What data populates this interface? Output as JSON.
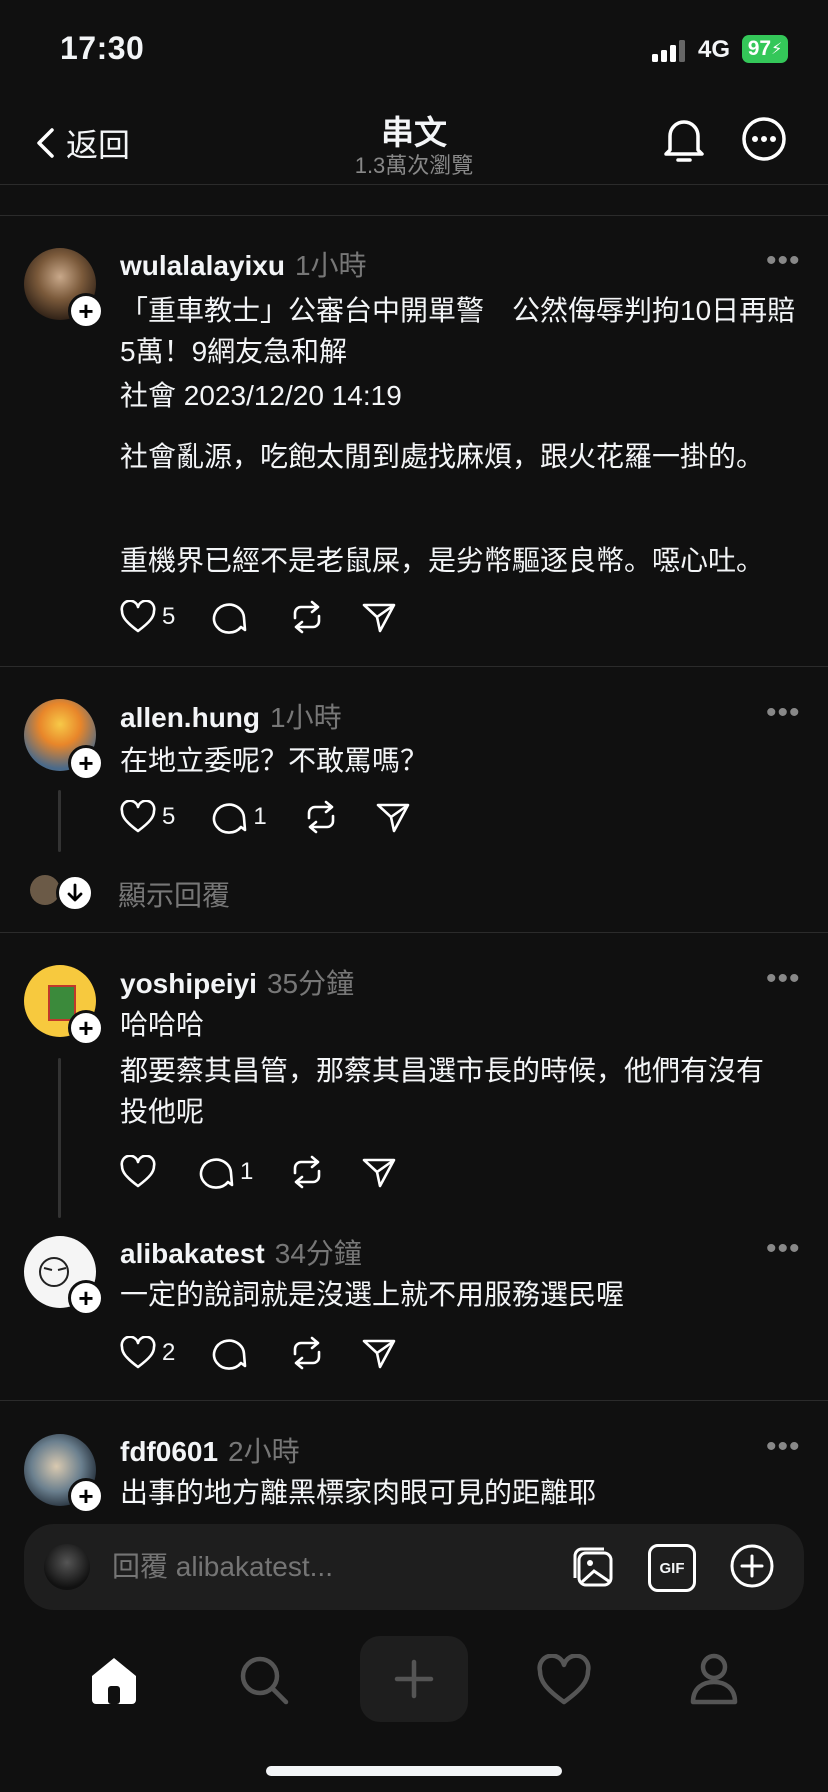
{
  "status": {
    "time": "17:30",
    "network": "4G",
    "battery": "97"
  },
  "header": {
    "back_label": "返回",
    "title": "串文",
    "views": "1.3萬次瀏覽"
  },
  "posts": [
    {
      "username": "wulalalayixu",
      "time": "1小時",
      "lines": [
        "「重車教士」公審台中開單警　公然侮辱判拘10日再賠5萬！9網友急和解",
        "社會 2023/12/20 14:19"
      ],
      "paragraphs": [
        "社會亂源，吃飽太閒到處找麻煩，跟火花羅一掛的。",
        "重機界已經不是老鼠屎，是劣幣驅逐良幣。噁心吐。"
      ],
      "likes": "5",
      "replies": ""
    },
    {
      "username": "allen.hung",
      "time": "1小時",
      "text": "在地立委呢？不敢罵嗎？",
      "likes": "5",
      "replies": "1",
      "show_replies": "顯示回覆"
    },
    {
      "username": "yoshipeiyi",
      "time": "35分鐘",
      "text1": "哈哈哈",
      "text2": "都要蔡其昌管，那蔡其昌選市長的時候，他們有沒有投他呢",
      "likes": "",
      "replies": "1"
    },
    {
      "username": "alibakatest",
      "time": "34分鐘",
      "text": "一定的說詞就是沒選上就不用服務選民喔",
      "likes": "2",
      "replies": ""
    },
    {
      "username": "fdf0601",
      "time": "2小時",
      "text": "出事的地方離黑標家肉眼可見的距離耶"
    }
  ],
  "composer": {
    "placeholder": "回覆 alibakatest...",
    "gif_label": "GIF"
  },
  "tabs": [
    "home-icon",
    "search-icon",
    "compose-icon",
    "heart-icon",
    "profile-icon"
  ]
}
